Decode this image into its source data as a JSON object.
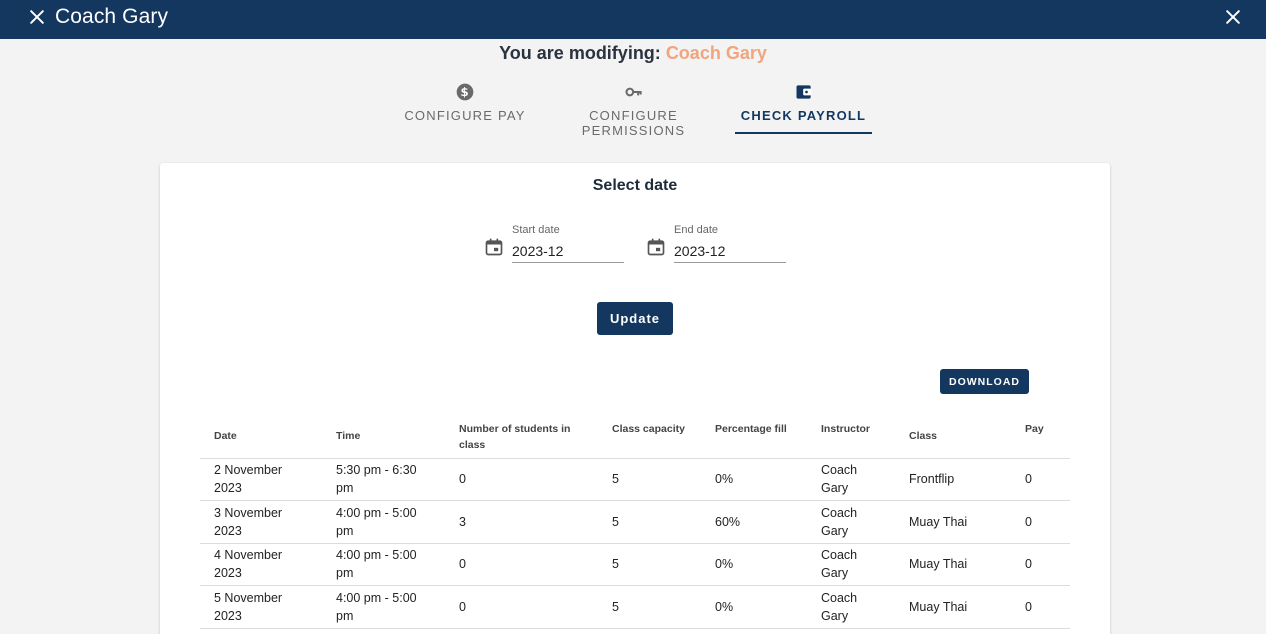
{
  "header": {
    "title": "Coach Gary"
  },
  "modifying": {
    "prefix": "You are modifying:",
    "name": "Coach Gary"
  },
  "tabs": [
    {
      "label": "CONFIGURE PAY",
      "icon": "dollar-circle-icon"
    },
    {
      "label": "CONFIGURE PERMISSIONS",
      "icon": "key-icon"
    },
    {
      "label": "CHECK PAYROLL",
      "icon": "wallet-icon",
      "active": true
    }
  ],
  "payroll": {
    "heading": "Select date",
    "start_date": {
      "label": "Start date",
      "value": "2023-12"
    },
    "end_date": {
      "label": "End date",
      "value": "2023-12"
    },
    "update_label": "Update",
    "download_label": "DOWNLOAD",
    "columns": [
      "Date",
      "Time",
      "Number of students in class",
      "Class capacity",
      "Percentage fill",
      "Instructor",
      "Class",
      "Pay"
    ],
    "rows": [
      [
        "2 November 2023",
        "5:30 pm - 6:30 pm",
        "0",
        "5",
        "0%",
        "Coach Gary",
        "Frontflip",
        "0"
      ],
      [
        "3 November 2023",
        "4:00 pm - 5:00 pm",
        "3",
        "5",
        "60%",
        "Coach Gary",
        "Muay Thai",
        "0"
      ],
      [
        "4 November 2023",
        "4:00 pm - 5:00 pm",
        "0",
        "5",
        "0%",
        "Coach Gary",
        "Muay Thai",
        "0"
      ],
      [
        "5 November 2023",
        "4:00 pm - 5:00 pm",
        "0",
        "5",
        "0%",
        "Coach Gary",
        "Muay Thai",
        "0"
      ]
    ]
  },
  "colors": {
    "primary": "#13375f",
    "accent_name": "#f0a57d"
  }
}
